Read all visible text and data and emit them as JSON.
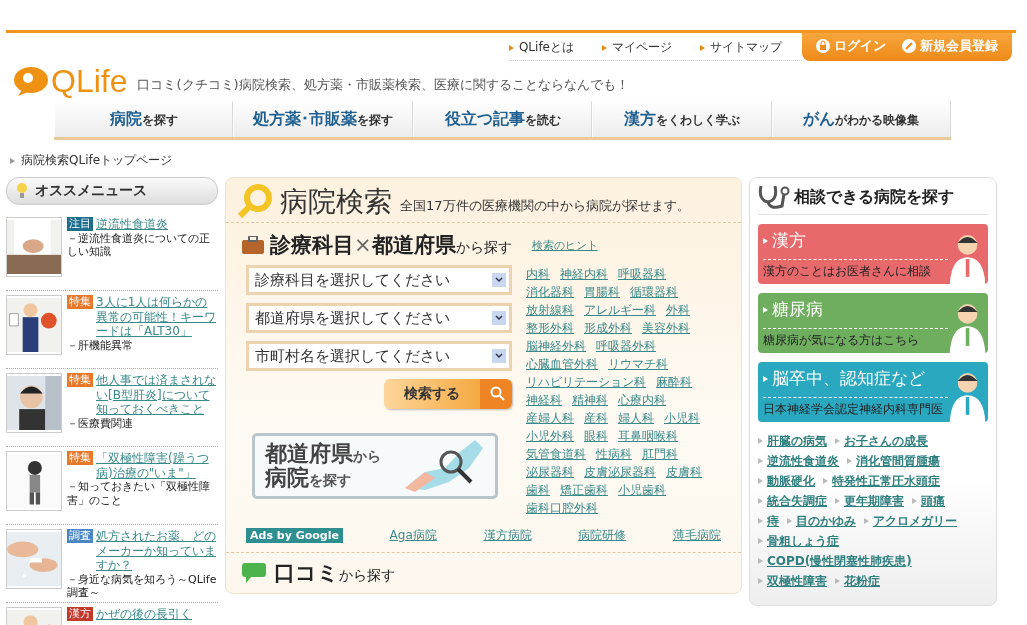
{
  "top_links": [
    "QLifeとは",
    "マイページ",
    "サイトマップ"
  ],
  "account_buttons": [
    {
      "label": "ログイン",
      "kind": "login"
    },
    {
      "label": "新規会員登録",
      "kind": "register"
    }
  ],
  "logo": "QLife",
  "tagline": "口コミ(クチコミ)病院検索、処方薬・市販薬検索、医療に関することならなんでも！",
  "nav": [
    {
      "main": "病院",
      "rest": "を探す"
    },
    {
      "main": "処方薬･市販薬",
      "rest": "を探す"
    },
    {
      "main": "役立つ記事",
      "rest": "を読む"
    },
    {
      "main": "漢方",
      "rest": "をくわしく学ぶ"
    },
    {
      "main": "がん",
      "rest": "がわかる映像集"
    }
  ],
  "breadcrumb": "病院検索QLifeトップページ",
  "news": {
    "title": "オススメニュース",
    "items": [
      {
        "tag": "注目",
        "color": "#1d6d8c",
        "link": "逆流性食道炎",
        "description": "－逆流性食道炎についての正しい知識"
      },
      {
        "tag": "特集",
        "color": "#e8772a",
        "link": "3人に1人は何らかの異常の可能性！キーワードは「ALT30」",
        "description": "－肝機能異常"
      },
      {
        "tag": "特集",
        "color": "#e8772a",
        "link": "他人事では済まされない[B型肝炎]について知っておくべきこと",
        "description": "－医療費関連"
      },
      {
        "tag": "特集",
        "color": "#e8772a",
        "link": "「双極性障害(躁うつ病)治療の\"いま\"」",
        "description": "－知っておきたい「双極性障害」のこと"
      },
      {
        "tag": "調査",
        "color": "#4a86c5",
        "link": "処方されたお薬、どのメーカーか知っていますか？",
        "description": "－身近な病気を知ろう～QLife調査～"
      },
      {
        "tag": "漢方",
        "color": "#c0392b",
        "link": "かぜの後の長引く"
      }
    ]
  },
  "search": {
    "title": "病院検索",
    "subtitle": "全国17万件の医療機関の中から病院が探せます。",
    "section_main": "診療科目",
    "section_times": "×",
    "section_main2": "都道府県",
    "section_rest": "から探す",
    "hint": "検索のヒント",
    "selects": [
      "診療科目を選択してください",
      "都道府県を選択してください",
      "市町村名を選択してください"
    ],
    "search_button": "検索する",
    "map_banner": {
      "line1_main": "都道府県",
      "line1_rest": "から",
      "line2_main": "病院",
      "line2_rest": "を探す"
    },
    "specialties": [
      [
        "内科",
        "神経内科",
        "呼吸器科"
      ],
      [
        "消化器科",
        "胃腸科",
        "循環器科"
      ],
      [
        "放射線科",
        "アレルギー科",
        "外科"
      ],
      [
        "整形外科",
        "形成外科",
        "美容外科"
      ],
      [
        "脳神経外科",
        "呼吸器外科"
      ],
      [
        "心臓血管外科",
        "リウマチ科"
      ],
      [
        "リハビリテーション科",
        "麻酔科"
      ],
      [
        "神経科",
        "精神科",
        "心療内科"
      ],
      [
        "産婦人科",
        "産科",
        "婦人科",
        "小児科"
      ],
      [
        "小児外科",
        "眼科",
        "耳鼻咽喉科"
      ],
      [
        "気管食道科",
        "性病科",
        "肛門科"
      ],
      [
        "泌尿器科",
        "皮膚泌尿器科",
        "皮膚科"
      ],
      [
        "歯科",
        "矯正歯科",
        "小児歯科"
      ],
      [
        "歯科口腔外科"
      ]
    ],
    "ads_label": "Ads by Google",
    "ads": [
      "Aga病院",
      "漢方病院",
      "病院研修",
      "薄毛病院"
    ],
    "review_main": "口コミ",
    "review_rest": "から探す"
  },
  "consult": {
    "title": "相談できる病院を探す",
    "cards": [
      {
        "title": "漢方",
        "subtitle": "漢方のことはお医者さんに相談",
        "color": "#e8696b"
      },
      {
        "title": "糖尿病",
        "subtitle": "糖尿病が気になる方はこちら",
        "color": "#6fae5f"
      },
      {
        "title": "脳卒中、認知症など",
        "subtitle": "日本神経学会認定神経内科専門医",
        "color": "#2aa8c0"
      }
    ],
    "links": [
      [
        "肝臓の病気",
        "お子さんの成長"
      ],
      [
        "逆流性食道炎",
        "消化管間質腫瘍"
      ],
      [
        "動脈硬化",
        "特発性正常圧水頭症"
      ],
      [
        "統合失調症",
        "更年期障害",
        "頭痛"
      ],
      [
        "痔",
        "目のかゆみ",
        "アクロメガリー"
      ],
      [
        "骨粗しょう症"
      ],
      [
        "COPD(慢性閉塞性肺疾患)"
      ],
      [
        "双極性障害",
        "花粉症"
      ]
    ]
  }
}
